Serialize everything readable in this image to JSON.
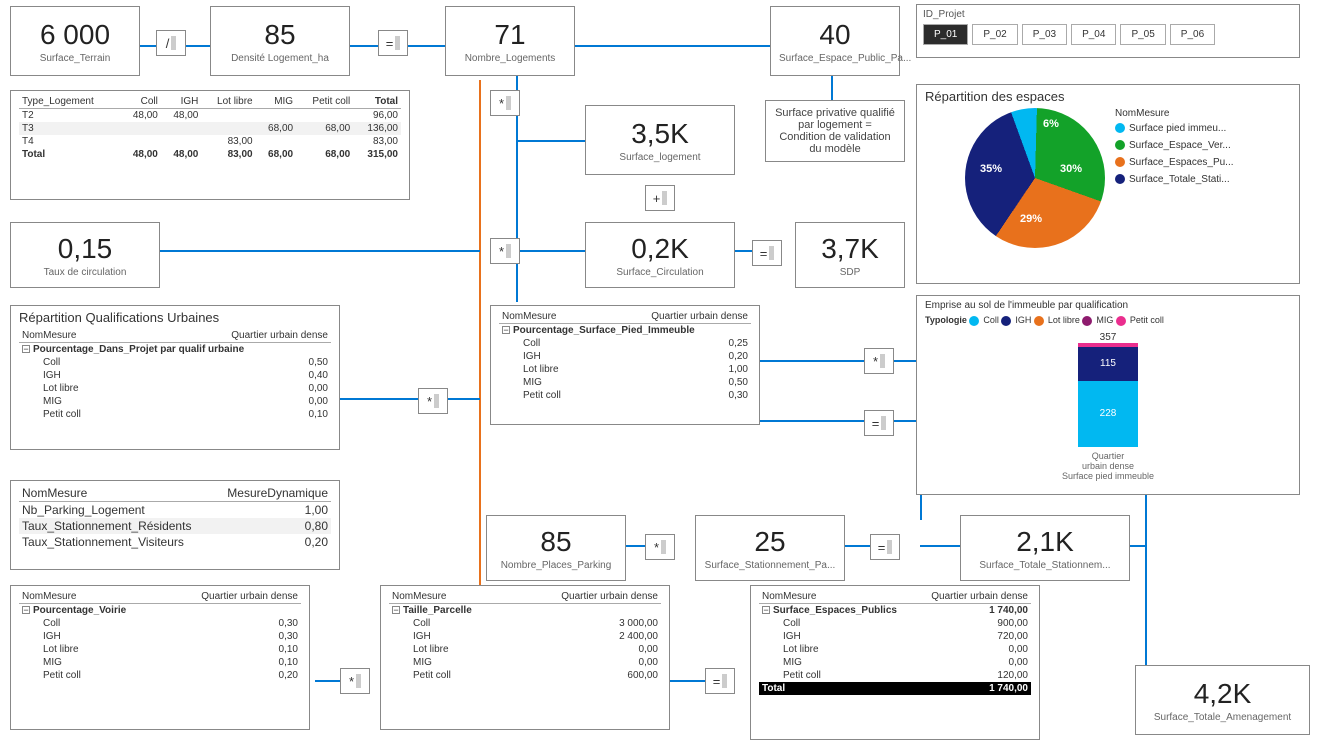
{
  "kpi": {
    "surface_terrain": {
      "val": "6 000",
      "lbl": "Surface_Terrain"
    },
    "densite": {
      "val": "85",
      "lbl": "Densité Logement_ha"
    },
    "nb_log": {
      "val": "71",
      "lbl": "Nombre_Logements"
    },
    "surf_esp_pub": {
      "val": "40",
      "lbl": "Surface_Espace_Public_Pa..."
    },
    "surf_log": {
      "val": "3,5K",
      "lbl": "Surface_logement"
    },
    "surf_circ": {
      "val": "0,2K",
      "lbl": "Surface_Circulation"
    },
    "sdp": {
      "val": "3,7K",
      "lbl": "SDP"
    },
    "taux_circ": {
      "val": "0,15",
      "lbl": "Taux de circulation"
    },
    "nb_parking": {
      "val": "85",
      "lbl": "Nombre_Places_Parking"
    },
    "surf_station_pa": {
      "val": "25",
      "lbl": "Surface_Stationnement_Pa..."
    },
    "surf_tot_station": {
      "val": "2,1K",
      "lbl": "Surface_Totale_Stationnem..."
    },
    "surf_tot_amen": {
      "val": "4,2K",
      "lbl": "Surface_Totale_Amenagement"
    }
  },
  "ops": {
    "div": "/",
    "eq": "=",
    "mul": "*",
    "plus": "+"
  },
  "note": "Surface privative qualifié par logement = Condition de validation du modèle",
  "slicer": {
    "title": "ID_Projet",
    "options": [
      "P_01",
      "P_02",
      "P_03",
      "P_04",
      "P_05",
      "P_06"
    ],
    "selected": "P_01"
  },
  "typo_table": {
    "headers": [
      "Type_Logement",
      "Coll",
      "IGH",
      "Lot libre",
      "MIG",
      "Petit coll",
      "Total"
    ],
    "rows": [
      {
        "k": "T2",
        "Coll": "48,00",
        "IGH": "48,00",
        "Lot": "",
        "MIG": "",
        "PC": "",
        "Total": "96,00"
      },
      {
        "k": "T3",
        "Coll": "",
        "IGH": "",
        "Lot": "",
        "MIG": "68,00",
        "PC": "68,00",
        "Total": "136,00"
      },
      {
        "k": "T4",
        "Coll": "",
        "IGH": "",
        "Lot": "83,00",
        "MIG": "",
        "PC": "",
        "Total": "83,00"
      },
      {
        "k": "Total",
        "Coll": "48,00",
        "IGH": "48,00",
        "Lot": "83,00",
        "MIG": "68,00",
        "PC": "68,00",
        "Total": "315,00"
      }
    ]
  },
  "qualif_urb": {
    "title": "Répartition Qualifications Urbaines",
    "col1": "NomMesure",
    "col2": "Quartier urbain dense",
    "group": "Pourcentage_Dans_Projet par qualif urbaine",
    "rows": [
      [
        "Coll",
        "0,50"
      ],
      [
        "IGH",
        "0,40"
      ],
      [
        "Lot libre",
        "0,00"
      ],
      [
        "MIG",
        "0,00"
      ],
      [
        "Petit coll",
        "0,10"
      ]
    ]
  },
  "pied_immeuble": {
    "col1": "NomMesure",
    "col2": "Quartier urbain dense",
    "group": "Pourcentage_Surface_Pied_Immeuble",
    "rows": [
      [
        "Coll",
        "0,25"
      ],
      [
        "IGH",
        "0,20"
      ],
      [
        "Lot libre",
        "1,00"
      ],
      [
        "MIG",
        "0,50"
      ],
      [
        "Petit coll",
        "0,30"
      ]
    ]
  },
  "parking_mes": {
    "col1": "NomMesure",
    "col2": "MesureDynamique",
    "rows": [
      [
        "Nb_Parking_Logement",
        "1,00"
      ],
      [
        "Taux_Stationnement_Résidents",
        "0,80"
      ],
      [
        "Taux_Stationnement_Visiteurs",
        "0,20"
      ]
    ]
  },
  "voirie": {
    "col1": "NomMesure",
    "col2": "Quartier urbain dense",
    "group": "Pourcentage_Voirie",
    "rows": [
      [
        "Coll",
        "0,30"
      ],
      [
        "IGH",
        "0,30"
      ],
      [
        "Lot libre",
        "0,10"
      ],
      [
        "MIG",
        "0,10"
      ],
      [
        "Petit coll",
        "0,20"
      ]
    ]
  },
  "parcelle": {
    "col1": "NomMesure",
    "col2": "Quartier urbain dense",
    "group": "Taille_Parcelle",
    "rows": [
      [
        "Coll",
        "3 000,00"
      ],
      [
        "IGH",
        "2 400,00"
      ],
      [
        "Lot libre",
        "0,00"
      ],
      [
        "MIG",
        "0,00"
      ],
      [
        "Petit coll",
        "600,00"
      ]
    ]
  },
  "esp_pub": {
    "col1": "NomMesure",
    "col2": "Quartier urbain dense",
    "group": "Surface_Espaces_Publics",
    "group_val": "1 740,00",
    "rows": [
      [
        "Coll",
        "900,00"
      ],
      [
        "IGH",
        "720,00"
      ],
      [
        "Lot libre",
        "0,00"
      ],
      [
        "MIG",
        "0,00"
      ],
      [
        "Petit coll",
        "120,00"
      ]
    ],
    "total_lbl": "Total",
    "total_val": "1 740,00"
  },
  "pie": {
    "title": "Répartition des espaces",
    "legend_title": "NomMesure",
    "items": [
      {
        "name": "Surface pied immeu...",
        "color": "#01B8F1",
        "pct": 6
      },
      {
        "name": "Surface_Espace_Ver...",
        "color": "#13A229",
        "pct": 30
      },
      {
        "name": "Surface_Espaces_Pu...",
        "color": "#E8711C",
        "pct": 29
      },
      {
        "name": "Surface_Totale_Stati...",
        "color": "#15217B",
        "pct": 35
      }
    ]
  },
  "stacked": {
    "title": "Emprise au sol de l'immeuble par qualification",
    "legend_lbl": "Typologie",
    "legend": [
      [
        "Coll",
        "#01B8F1"
      ],
      [
        "IGH",
        "#15217B"
      ],
      [
        "Lot libre",
        "#E8711C"
      ],
      [
        "MIG",
        "#8E1B6E"
      ],
      [
        "Petit coll",
        "#EA2E8E"
      ]
    ],
    "total": "357",
    "segs": [
      {
        "v": "115",
        "c": "#15217B",
        "h": 34
      },
      {
        "v": "228",
        "c": "#01B8F1",
        "h": 66
      }
    ],
    "caption1": "Quartier",
    "caption2": "urbain dense",
    "caption3": "Surface pied immeuble"
  },
  "chart_data": {
    "pie": {
      "type": "pie",
      "title": "Répartition des espaces",
      "series": [
        {
          "name": "NomMesure",
          "slices": [
            {
              "label": "Surface pied immeuble",
              "value": 6,
              "color": "#01B8F1"
            },
            {
              "label": "Surface_Espace_Vert",
              "value": 30,
              "color": "#13A229"
            },
            {
              "label": "Surface_Espaces_Publics",
              "value": 29,
              "color": "#E8711C"
            },
            {
              "label": "Surface_Totale_Stationnement",
              "value": 35,
              "color": "#15217B"
            }
          ]
        }
      ]
    },
    "stacked_bar": {
      "type": "bar",
      "stacked": true,
      "title": "Emprise au sol de l'immeuble par qualification",
      "categories": [
        "Quartier urbain dense — Surface pied immeuble"
      ],
      "total": 357,
      "series": [
        {
          "name": "Petit coll",
          "values": [
            14
          ],
          "color": "#EA2E8E"
        },
        {
          "name": "IGH",
          "values": [
            115
          ],
          "color": "#15217B"
        },
        {
          "name": "Coll",
          "values": [
            228
          ],
          "color": "#01B8F1"
        }
      ],
      "legend": [
        "Coll",
        "IGH",
        "Lot libre",
        "MIG",
        "Petit coll"
      ]
    }
  }
}
